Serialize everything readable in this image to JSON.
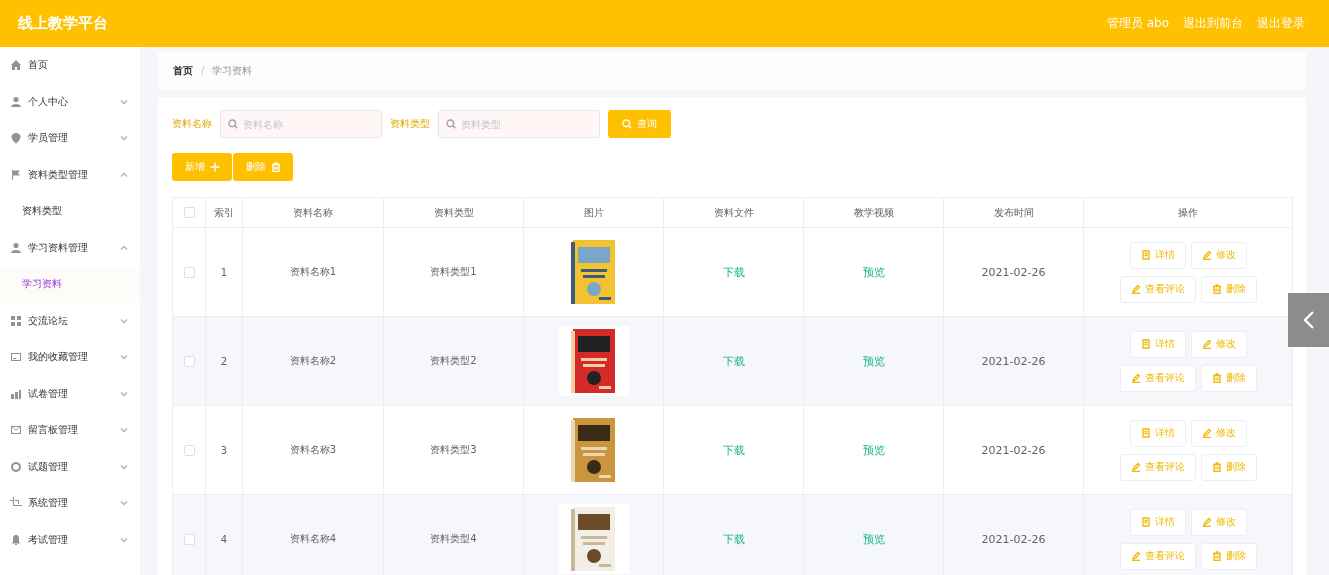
{
  "header": {
    "title": "线上教学平台",
    "links": [
      "管理员 abo",
      "退出到前台",
      "退出登录"
    ]
  },
  "sidebar": {
    "items": [
      {
        "label": "首页",
        "kind": "link",
        "selected": false
      },
      {
        "label": "个人中心",
        "kind": "submenu",
        "expanded": false,
        "selected": false
      },
      {
        "label": "学员管理",
        "kind": "submenu",
        "expanded": false,
        "selected": false
      },
      {
        "label": "资料类型管理",
        "kind": "submenu",
        "expanded": true,
        "selected": false,
        "children": [
          {
            "label": "资料类型",
            "selected": false
          }
        ]
      },
      {
        "label": "学习资料管理",
        "kind": "submenu",
        "expanded": true,
        "selected": false,
        "children": [
          {
            "label": "学习资料",
            "selected": true
          }
        ]
      },
      {
        "label": "交流论坛",
        "kind": "submenu",
        "expanded": false,
        "selected": false
      },
      {
        "label": "我的收藏管理",
        "kind": "submenu",
        "expanded": false,
        "selected": false
      },
      {
        "label": "试卷管理",
        "kind": "submenu",
        "expanded": false,
        "selected": false
      },
      {
        "label": "留言板管理",
        "kind": "submenu",
        "expanded": false,
        "selected": false
      },
      {
        "label": "试题管理",
        "kind": "submenu",
        "expanded": false,
        "selected": false
      },
      {
        "label": "系统管理",
        "kind": "submenu",
        "expanded": false,
        "selected": false
      },
      {
        "label": "考试管理",
        "kind": "submenu",
        "expanded": false,
        "selected": false
      }
    ]
  },
  "breadcrumb": {
    "items": [
      "首页",
      "学习资料"
    ],
    "separator": "/"
  },
  "search": {
    "fields": [
      {
        "label": "资料名称",
        "placeholder": "资料名称"
      },
      {
        "label": "资料类型",
        "placeholder": "资料类型"
      }
    ],
    "button": "查询"
  },
  "actions": [
    "新增",
    "删除"
  ],
  "table": {
    "select_all": {
      "checked": false
    },
    "columns": [
      "索引",
      "资料名称",
      "资料类型",
      "图片",
      "资料文件",
      "教学视频",
      "发布时间",
      "操作"
    ],
    "rows": [
      {
        "checked": false,
        "index": "1",
        "name": "资料名称1",
        "type": "资料类型1",
        "file": "下载",
        "video": "预览",
        "date": "2021-02-26",
        "buttons": [
          "详情",
          "修改",
          "查看评论",
          "删除"
        ]
      },
      {
        "checked": false,
        "index": "2",
        "name": "资料名称2",
        "type": "资料类型2",
        "file": "下载",
        "video": "预览",
        "date": "2021-02-26",
        "buttons": [
          "详情",
          "修改",
          "查看评论",
          "删除"
        ]
      },
      {
        "checked": false,
        "index": "3",
        "name": "资料名称3",
        "type": "资料类型3",
        "file": "下载",
        "video": "预览",
        "date": "2021-02-26",
        "buttons": [
          "详情",
          "修改",
          "查看评论",
          "删除"
        ]
      },
      {
        "checked": false,
        "index": "4",
        "name": "资料名称4",
        "type": "资料类型4",
        "file": "下载",
        "video": "预览",
        "date": "2021-02-26",
        "buttons": [
          "详情",
          "修改",
          "查看评论",
          "删除"
        ]
      }
    ]
  }
}
